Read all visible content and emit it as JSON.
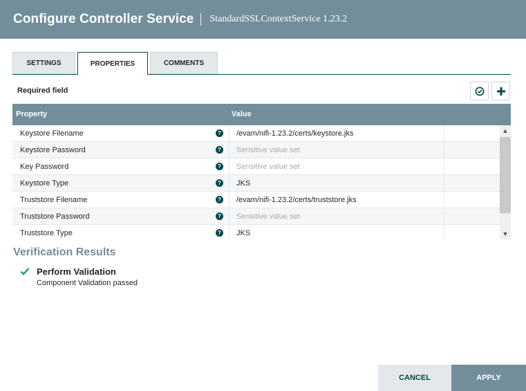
{
  "dialog": {
    "title": "Configure Controller Service",
    "subtitle": "StandardSSLContextService 1.23.2"
  },
  "tabs": [
    {
      "label": "SETTINGS",
      "active": false
    },
    {
      "label": "PROPERTIES",
      "active": true
    },
    {
      "label": "COMMENTS",
      "active": false
    }
  ],
  "properties": {
    "required_label": "Required field",
    "verify_icon": "check-circle-icon",
    "add_icon": "plus-icon",
    "columns": {
      "property": "Property",
      "value": "Value"
    },
    "help_glyph": "?",
    "rows": [
      {
        "name": "Keystore Filename",
        "value": "/evam/nifi-1.23.2/certs/keystore.jks",
        "sensitive": false
      },
      {
        "name": "Keystore Password",
        "value": "Sensitive value set",
        "sensitive": true
      },
      {
        "name": "Key Password",
        "value": "Sensitive value set",
        "sensitive": true
      },
      {
        "name": "Keystore Type",
        "value": "JKS",
        "sensitive": false
      },
      {
        "name": "Truststore Filename",
        "value": "/evam/nifi-1.23.2/certs/truststore.jks",
        "sensitive": false
      },
      {
        "name": "Truststore Password",
        "value": "Sensitive value set",
        "sensitive": true
      },
      {
        "name": "Truststore Type",
        "value": "JKS",
        "sensitive": false
      }
    ]
  },
  "verification": {
    "title": "Verification Results",
    "items": [
      {
        "name": "Perform Validation",
        "detail": "Component Validation passed",
        "status": "passed",
        "status_color": "#1ba365"
      }
    ]
  },
  "footer": {
    "cancel_label": "CANCEL",
    "apply_label": "APPLY"
  },
  "colors": {
    "header": "#728e9b",
    "accent": "#004849"
  }
}
